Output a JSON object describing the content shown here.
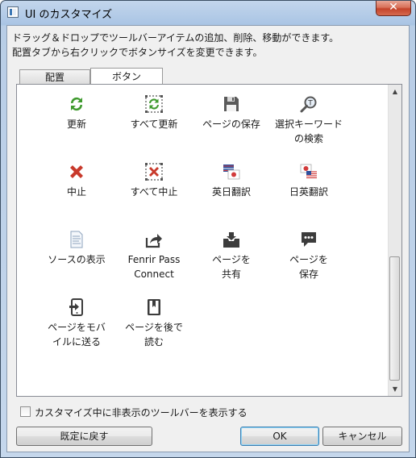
{
  "window": {
    "title": "UI のカスタマイズ",
    "close_glyph": "✕"
  },
  "instructions": {
    "line1": "ドラッグ＆ドロップでツールバーアイテムの追加、削除、移動ができます。",
    "line2": "配置タブから右クリックでボタンサイズを変更できます。"
  },
  "tabs": {
    "haichi": "配置",
    "button": "ボタン",
    "active": "ボタン"
  },
  "items": [
    {
      "l1": "更新",
      "l2": "",
      "icon": "refresh-icon"
    },
    {
      "l1": "すべて更新",
      "l2": "",
      "icon": "refresh-all-icon"
    },
    {
      "l1": "ページの保存",
      "l2": "",
      "icon": "floppy-disk-icon"
    },
    {
      "l1": "選択キーワード",
      "l2": "の検索",
      "icon": "magnifier-icon"
    },
    {
      "l1": "中止",
      "l2": "",
      "icon": "stop-icon"
    },
    {
      "l1": "すべて中止",
      "l2": "",
      "icon": "stop-all-icon"
    },
    {
      "l1": "英日翻訳",
      "l2": "",
      "icon": "translate-en-ja-icon"
    },
    {
      "l1": "日英翻訳",
      "l2": "",
      "icon": "translate-ja-en-icon"
    },
    {
      "l1": "ソースの表示",
      "l2": "",
      "icon": "source-document-icon"
    },
    {
      "l1": "Fenrir Pass",
      "l2": "Connect",
      "icon": "share-arrow-icon"
    },
    {
      "l1": "ページを",
      "l2": "共有",
      "icon": "inbox-share-icon"
    },
    {
      "l1": "ページを",
      "l2": "保存",
      "icon": "speech-bubble-icon"
    },
    {
      "l1": "ページをモバ",
      "l2": "イルに送る",
      "icon": "send-to-mobile-icon"
    },
    {
      "l1": "ページを後で",
      "l2": "読む",
      "icon": "bookmark-book-icon"
    }
  ],
  "scrollbar": {
    "up_glyph": "▲",
    "down_glyph": "▼"
  },
  "checkbox": {
    "label": "カスタマイズ中に非表示のツールバーを表示する",
    "checked": false
  },
  "buttons": {
    "reset": "既定に戻す",
    "ok": "OK",
    "cancel": "キャンセル"
  },
  "colors": {
    "accent_green": "#3f9a2e",
    "stop_red": "#c8392b",
    "icon_dark": "#3c3c3c"
  }
}
